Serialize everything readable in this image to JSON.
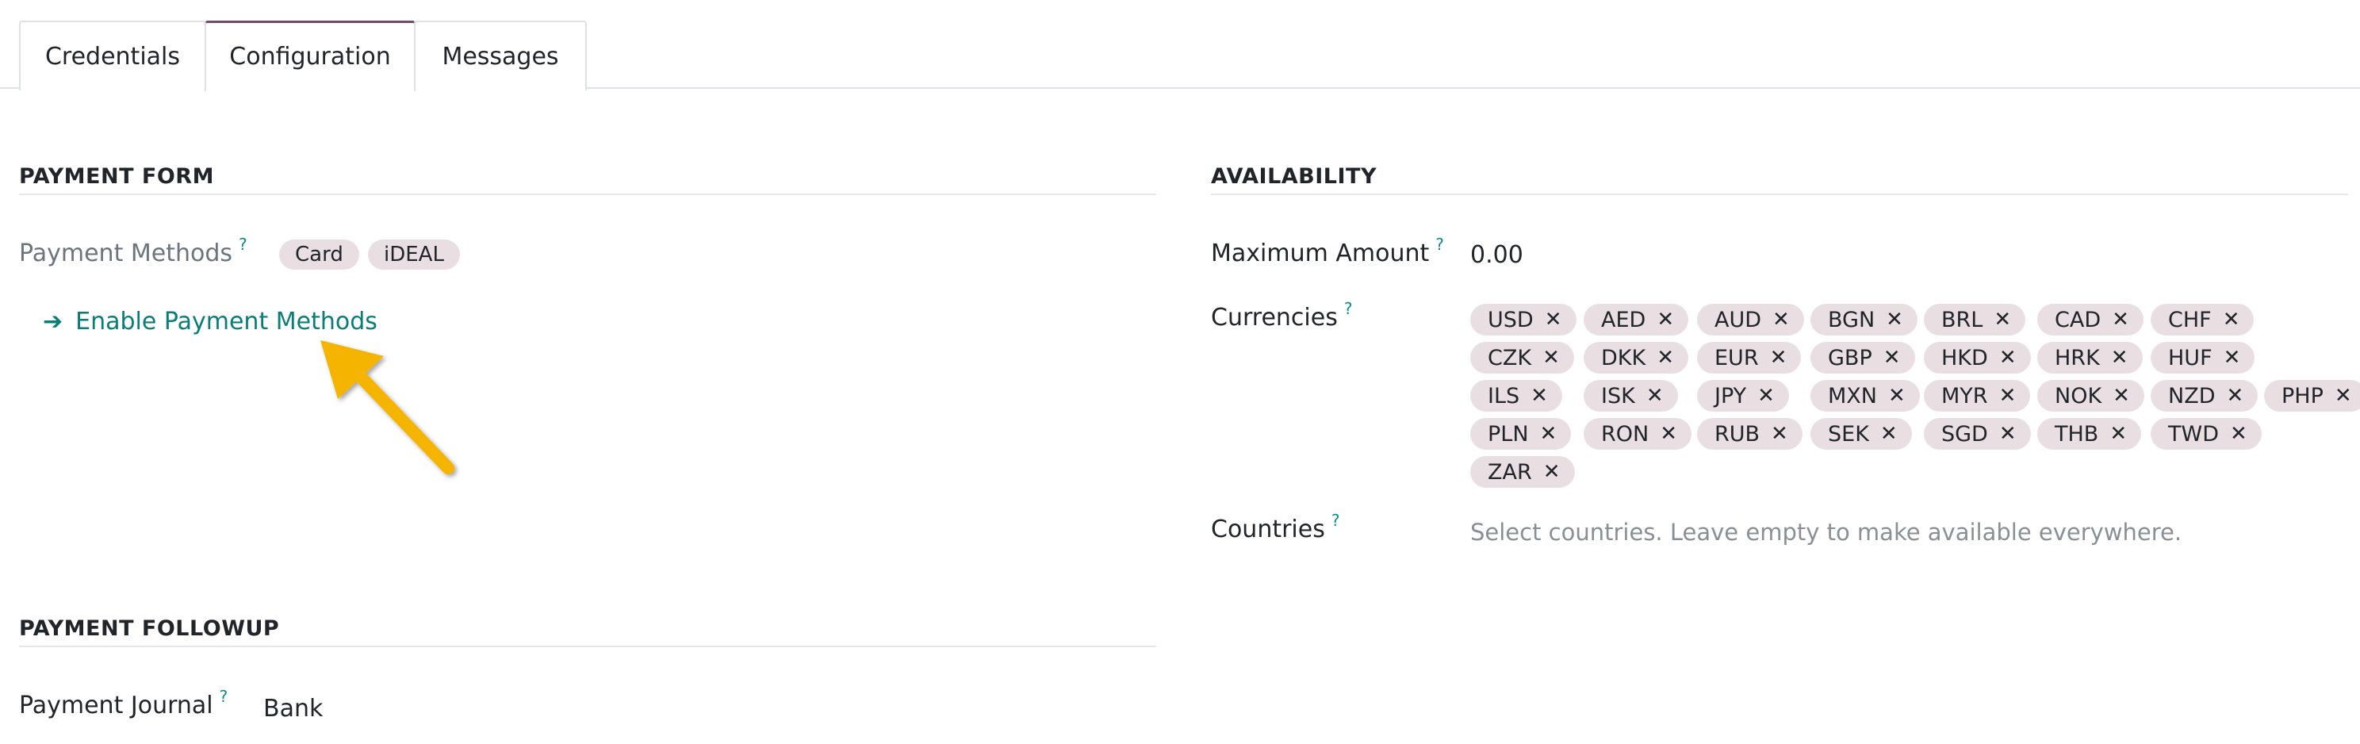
{
  "tabs": [
    {
      "label": "Credentials",
      "active": false
    },
    {
      "label": "Configuration",
      "active": true
    },
    {
      "label": "Messages",
      "active": false
    }
  ],
  "payment_form": {
    "title": "PAYMENT FORM",
    "payment_methods_label": "Payment Methods",
    "payment_methods": [
      "Card",
      "iDEAL"
    ],
    "enable_link_label": "Enable Payment Methods",
    "help_mark": "?"
  },
  "payment_followup": {
    "title": "PAYMENT FOLLOWUP",
    "journal_label": "Payment Journal",
    "journal_value": "Bank",
    "help_mark": "?"
  },
  "availability": {
    "title": "AVAILABILITY",
    "max_amount_label": "Maximum Amount",
    "max_amount_value": "0.00",
    "currencies_label": "Currencies",
    "currencies_rows": [
      [
        "USD",
        "AED",
        "AUD",
        "BGN",
        "BRL",
        "CAD",
        "CHF"
      ],
      [
        "CZK",
        "DKK",
        "EUR",
        "GBP",
        "HKD",
        "HRK",
        "HUF"
      ],
      [
        "ILS",
        "ISK",
        "JPY",
        "MXN",
        "MYR",
        "NOK",
        "NZD",
        "PHP"
      ],
      [
        "PLN",
        "RON",
        "RUB",
        "SEK",
        "SGD",
        "THB",
        "TWD"
      ],
      [
        "ZAR"
      ]
    ],
    "countries_label": "Countries",
    "countries_placeholder": "Select countries. Leave empty to make available everywhere.",
    "help_mark": "?",
    "remove_mark": "✕"
  },
  "colors": {
    "accent": "#714b67",
    "link": "#0a7d77",
    "help": "#0b8d84",
    "tag_bg": "#e9dfe2",
    "annotation_arrow": "#f5b400"
  },
  "icons": {
    "arrow_right": "➔",
    "annotation": "yellow-pointer-arrow-icon"
  }
}
